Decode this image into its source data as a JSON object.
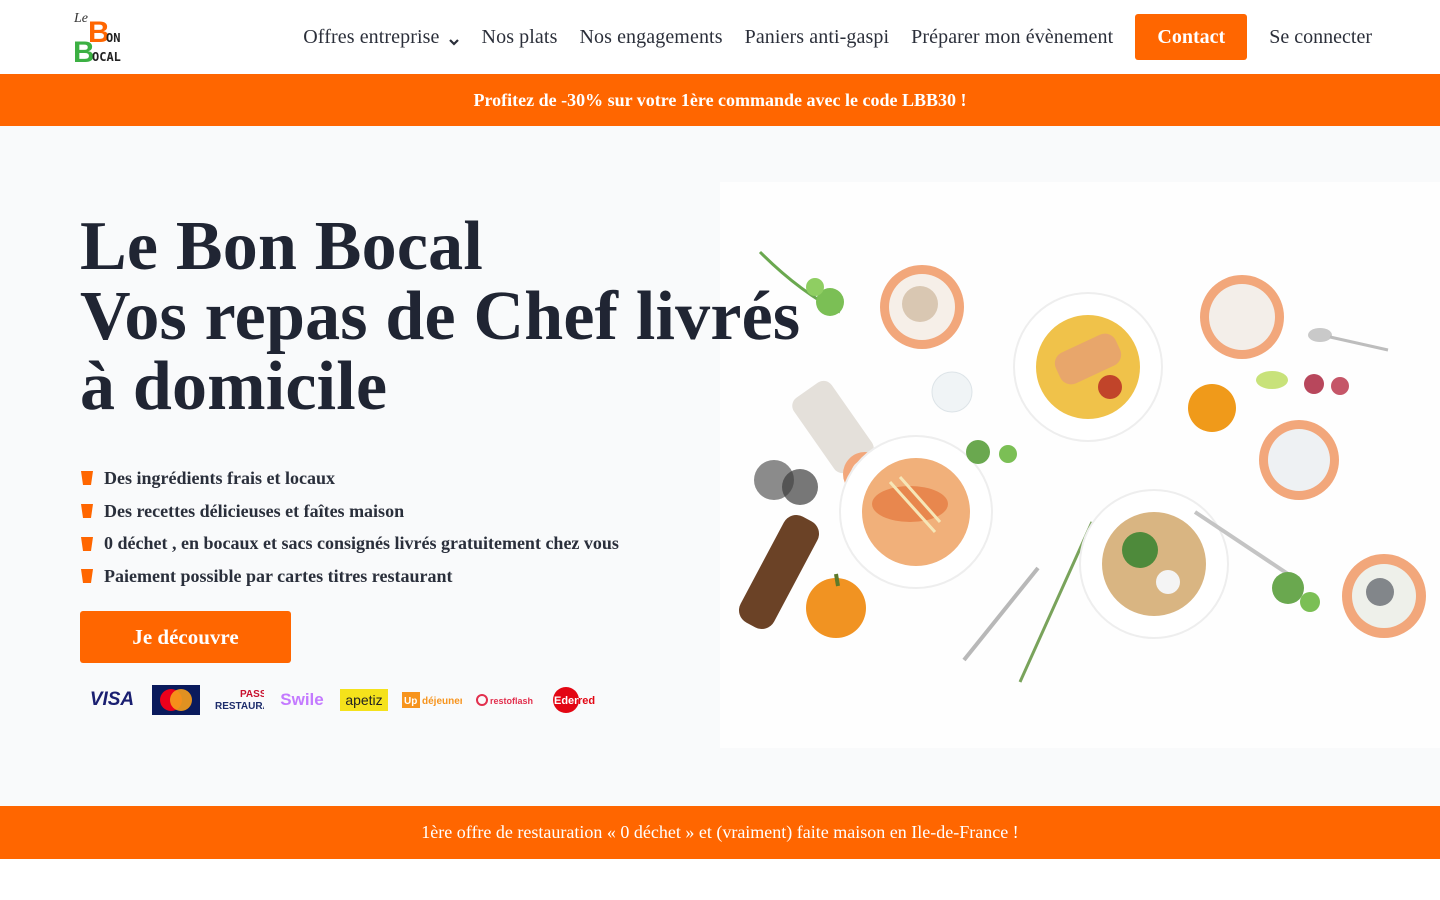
{
  "brand": {
    "logo_text": [
      "Le",
      "Bon",
      "Bocal"
    ],
    "accent_color": "#ff6600",
    "logo_green": "#3cb043"
  },
  "nav": {
    "items": [
      {
        "label": "Offres entreprise",
        "has_dropdown": true
      },
      {
        "label": "Nos plats"
      },
      {
        "label": "Nos engagements"
      },
      {
        "label": "Paniers anti-gaspi"
      },
      {
        "label": "Préparer mon évènement"
      }
    ],
    "contact_label": "Contact",
    "login_label": "Se connecter"
  },
  "promo_text": "Profitez de -30% sur votre 1ère commande avec le code LBB30 !",
  "hero": {
    "title_lines": [
      "Le Bon Bocal",
      "Vos repas de Chef livrés",
      "à domicile"
    ],
    "bullets": [
      "Des ingrédients frais et locaux",
      "Des recettes délicieuses et faîtes maison",
      "0 déchet , en bocaux et sacs consignés livrés gratuitement chez vous",
      "Paiement possible par cartes titres restaurant"
    ],
    "cta_label": "Je découvre",
    "payment_logos": [
      {
        "name": "VISA",
        "icon": "visa-logo"
      },
      {
        "name": "MasterCard",
        "icon": "mastercard-logo"
      },
      {
        "name": "Pass Restaurant",
        "icon": "pass-restaurant-logo"
      },
      {
        "name": "Swile",
        "icon": "swile-logo"
      },
      {
        "name": "apetiz",
        "icon": "apetiz-logo"
      },
      {
        "name": "Up déjeuner",
        "icon": "up-dejeuner-logo"
      },
      {
        "name": "restoflash",
        "icon": "restoflash-logo"
      },
      {
        "name": "Edenred",
        "icon": "edenred-logo"
      }
    ],
    "image_icon": "food-spread-photo"
  },
  "bottom_band_text": "1ère offre de restauration « 0 déchet » et (vraiment) faite maison en Ile-de-France !"
}
